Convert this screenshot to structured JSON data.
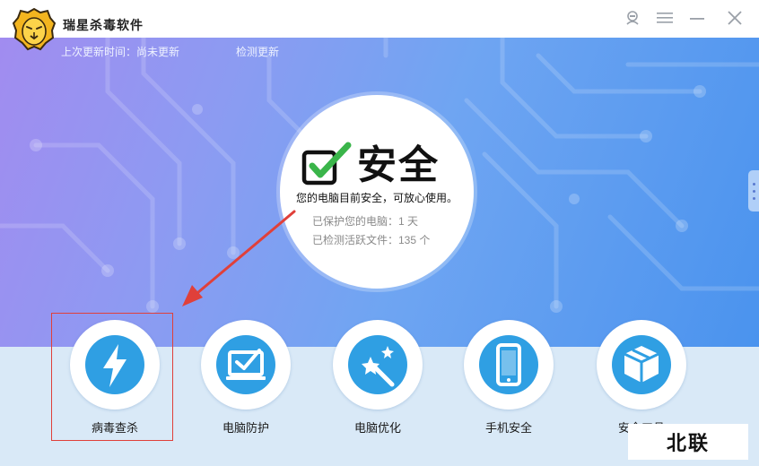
{
  "app": {
    "title": "瑞星杀毒软件",
    "logo_icon": "lion-head-icon"
  },
  "window_controls": [
    "user-icon",
    "menu-icon",
    "minimize-icon",
    "close-icon"
  ],
  "update": {
    "last_update": "上次更新时间：尚未更新",
    "check_label": "检测更新"
  },
  "status": {
    "word": "安全",
    "description": "您的电脑目前安全，可放心使用。",
    "protected_days": "已保护您的电脑：1 天",
    "active_files": "已检测活跃文件：135 个"
  },
  "features": [
    {
      "label": "病毒查杀",
      "icon": "lightning-icon"
    },
    {
      "label": "电脑防护",
      "icon": "monitor-check-icon"
    },
    {
      "label": "电脑优化",
      "icon": "magic-wand-icon"
    },
    {
      "label": "手机安全",
      "icon": "phone-icon"
    },
    {
      "label": "安全工具",
      "icon": "toolbox-icon"
    }
  ],
  "watermark": "北联",
  "colors": {
    "accent_blue": "#2f9fe3",
    "check_green": "#3ab54a",
    "highlight_red": "#e0403a",
    "panel_bg": "#d9e9f7"
  }
}
